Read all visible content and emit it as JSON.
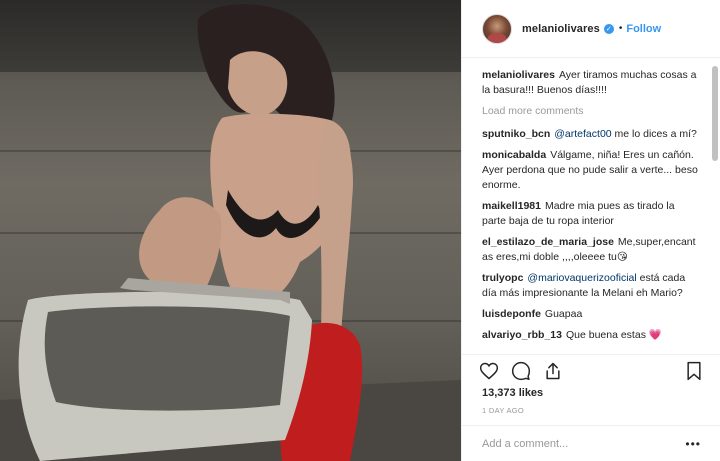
{
  "post": {
    "image_alt": "photo"
  },
  "header": {
    "username": "melaniolivares",
    "separator": "•",
    "follow_label": "Follow"
  },
  "caption": {
    "username": "melaniolivares",
    "text": "Ayer tiramos muchas cosas a la basura!!! Buenos días!!!!"
  },
  "load_more_label": "Load more comments",
  "comments": [
    {
      "username": "sputniko_bcn",
      "mention": "@artefact00",
      "text": " me lo dices a mí?"
    },
    {
      "username": "monicabalda",
      "mention": "",
      "text": "Válgame, niña! Eres un cañón. Ayer perdona que no pude salir a verte... beso enorme."
    },
    {
      "username": "maikell1981",
      "mention": "",
      "text": "Madre mia pues as tirado la parte baja de tu ropa interior"
    },
    {
      "username": "el_estilazo_de_maria_jose",
      "mention": "",
      "text": "Me,super,encantas eres,mi doble ,,,,oleeee tu😘"
    },
    {
      "username": "trulyopc",
      "mention": "@mariovaquerizooficial",
      "text": " está cada día más impresionante la Melani eh Mario?"
    },
    {
      "username": "luisdeponfe",
      "mention": "",
      "text": "Guapaa"
    },
    {
      "username": "alvariyo_rbb_13",
      "mention": "",
      "text": "Que buena estas 💗"
    }
  ],
  "likes": "13,373 likes",
  "time_ago": "1 DAY AGO",
  "add_comment": {
    "placeholder": "Add a comment...",
    "value": "",
    "more_label": "•••"
  },
  "icons": {
    "heart": "heart-icon",
    "comment": "comment-icon",
    "share": "share-icon",
    "bookmark": "bookmark-icon",
    "verified": "verified-badge-icon"
  },
  "colors": {
    "accent": "#3897f0",
    "mention": "#003569",
    "muted": "#999999",
    "border": "#efefef"
  }
}
